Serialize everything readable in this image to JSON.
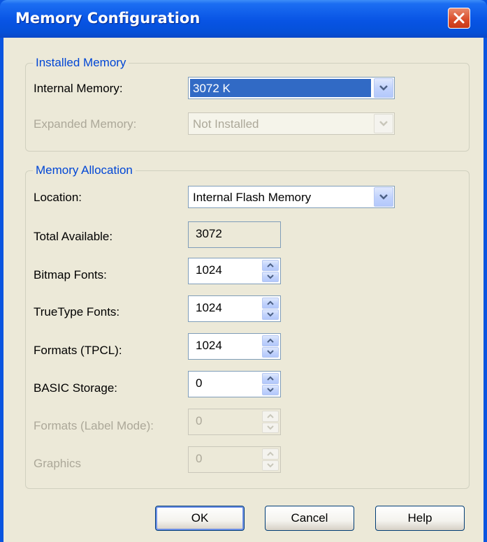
{
  "window": {
    "title": "Memory Configuration"
  },
  "installed": {
    "group_title": "Installed Memory",
    "internal_label": "Internal Memory:",
    "internal_value": "3072 K",
    "expanded_label": "Expanded Memory:",
    "expanded_value": "Not Installed"
  },
  "allocation": {
    "group_title": "Memory Allocation",
    "location_label": "Location:",
    "location_value": "Internal Flash Memory",
    "total_label": "Total Available:",
    "total_value": "3072",
    "rows": [
      {
        "label": "Bitmap Fonts:",
        "value": "1024",
        "enabled": true
      },
      {
        "label": "TrueType Fonts:",
        "value": "1024",
        "enabled": true
      },
      {
        "label": "Formats (TPCL):",
        "value": "1024",
        "enabled": true
      },
      {
        "label": "BASIC Storage:",
        "value": "0",
        "enabled": true
      },
      {
        "label": "Formats (Label Mode):",
        "value": "0",
        "enabled": false
      },
      {
        "label": "Graphics",
        "value": "0",
        "enabled": false
      }
    ]
  },
  "buttons": {
    "ok": "OK",
    "cancel": "Cancel",
    "help": "Help"
  },
  "icons": {
    "close": "close-icon",
    "dropdown": "chevron-down-icon",
    "spin_up": "arrow-up-icon",
    "spin_down": "arrow-down-icon"
  },
  "colors": {
    "title_bar": "#0854e4",
    "group_title": "#0046d5",
    "selection": "#316ac5",
    "dialog_bg": "#ece9d8"
  }
}
